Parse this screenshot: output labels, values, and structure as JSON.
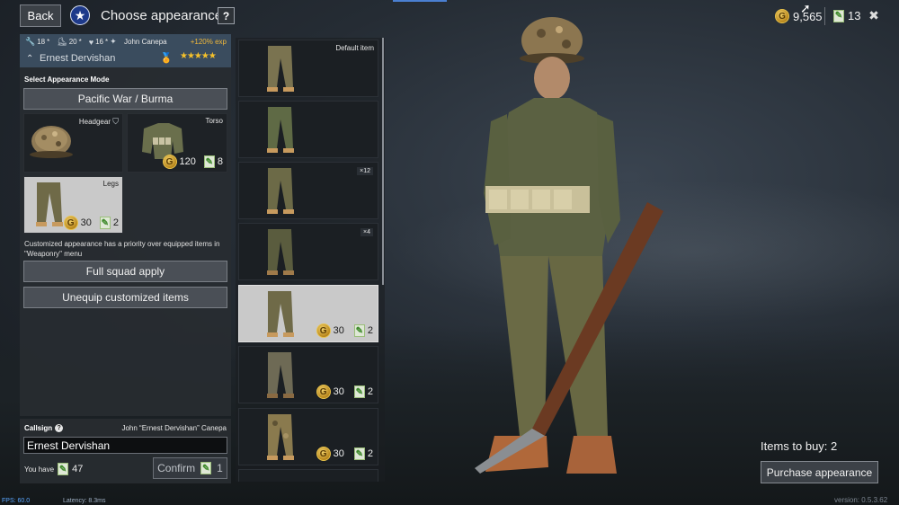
{
  "header": {
    "back_label": "Back",
    "title": "Choose appearance",
    "help_label": "?",
    "silver_amount": "9,565",
    "ticket_amount": "13",
    "close_glyph": "✖"
  },
  "soldier": {
    "stats": [
      {
        "icon": "wrench-icon",
        "value": "18"
      },
      {
        "icon": "boot-icon",
        "value": "20"
      },
      {
        "icon": "heart-icon",
        "value": "16"
      }
    ],
    "commander": "John Canepa",
    "exp_bonus": "+120% exp",
    "name": "Ernest Dervishan",
    "rating": "★★★★★"
  },
  "appearance": {
    "section_label": "Select Appearance Mode",
    "mode": "Pacific War / Burma",
    "slots": [
      {
        "label": "Headgear"
      },
      {
        "label": "Torso",
        "price": "120",
        "tickets": "8"
      },
      {
        "label": "Legs",
        "price": "30",
        "tickets": "2"
      }
    ],
    "note": "Customized appearance has a priority over equipped items in \"Weaponry\" menu",
    "squad_apply": "Full squad apply",
    "unequip": "Unequip customized items"
  },
  "callsign": {
    "label": "Callsign",
    "help": "?",
    "full_name": "John “Ernest Dervishan” Canepa",
    "value": "Ernest Dervishan",
    "you_have_label": "You have",
    "you_have_amount": "47",
    "confirm_label": "Confirm",
    "confirm_cost": "1"
  },
  "items": [
    {
      "tag": "Default item"
    },
    {},
    {
      "count": "×12"
    },
    {
      "count": "×4"
    },
    {
      "price": "30",
      "tickets": "2",
      "selected": true
    },
    {
      "price": "30",
      "tickets": "2"
    },
    {
      "price": "30",
      "tickets": "2"
    }
  ],
  "footer": {
    "items_to_buy": "Items to buy: 2",
    "purchase_label": "Purchase appearance",
    "fps": "FPS: 60.0",
    "latency": "Latency: 8.3ms",
    "version": "version: 0.5.3.62"
  },
  "colors": {
    "accent_blue": "#4a7fd1",
    "gold": "#f5c12b",
    "exp_orange": "#f0b83a",
    "panel": "#282c31"
  }
}
